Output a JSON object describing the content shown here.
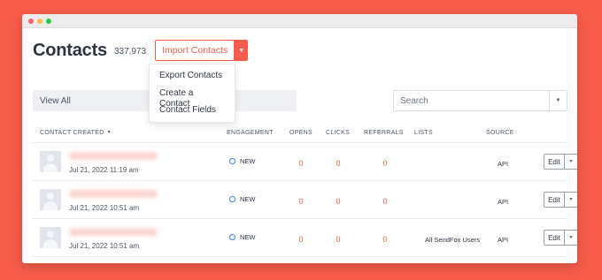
{
  "window": {
    "dots": [
      "close",
      "minimize",
      "maximize"
    ]
  },
  "header": {
    "title": "Contacts",
    "count": "337,973",
    "import_label": "Import Contacts",
    "import_caret_icon": "caret-down-icon"
  },
  "dropdown": {
    "items": [
      "Export Contacts",
      "Create a Contact",
      "Contact Fields"
    ]
  },
  "filter": {
    "label": "View All"
  },
  "search": {
    "placeholder": "Search",
    "value": ""
  },
  "table": {
    "columns": [
      "CONTACT CREATED",
      "ENGAGEMENT",
      "OPENS",
      "CLICKS",
      "REFERRALS",
      "LISTS",
      "SOURCE"
    ],
    "sort_icon": "▼",
    "rows": [
      {
        "date": "Jul 21, 2022 11:19 am",
        "engagement": "NEW",
        "opens": "0",
        "clicks": "0",
        "referrals": "0",
        "lists": "",
        "source": "API",
        "edit_label": "Edit"
      },
      {
        "date": "Jul 21, 2022 10:51 am",
        "engagement": "NEW",
        "opens": "0",
        "clicks": "0",
        "referrals": "0",
        "lists": "",
        "source": "API",
        "edit_label": "Edit"
      },
      {
        "date": "Jul 21, 2022 10:51 am",
        "engagement": "NEW",
        "opens": "0",
        "clicks": "0",
        "referrals": "0",
        "lists": "All SendFox Users",
        "source": "API",
        "edit_label": "Edit"
      }
    ]
  },
  "colors": {
    "accent": "#f75c4a",
    "background": "#f75c4a",
    "engagement_ring": "#3b82f6"
  }
}
